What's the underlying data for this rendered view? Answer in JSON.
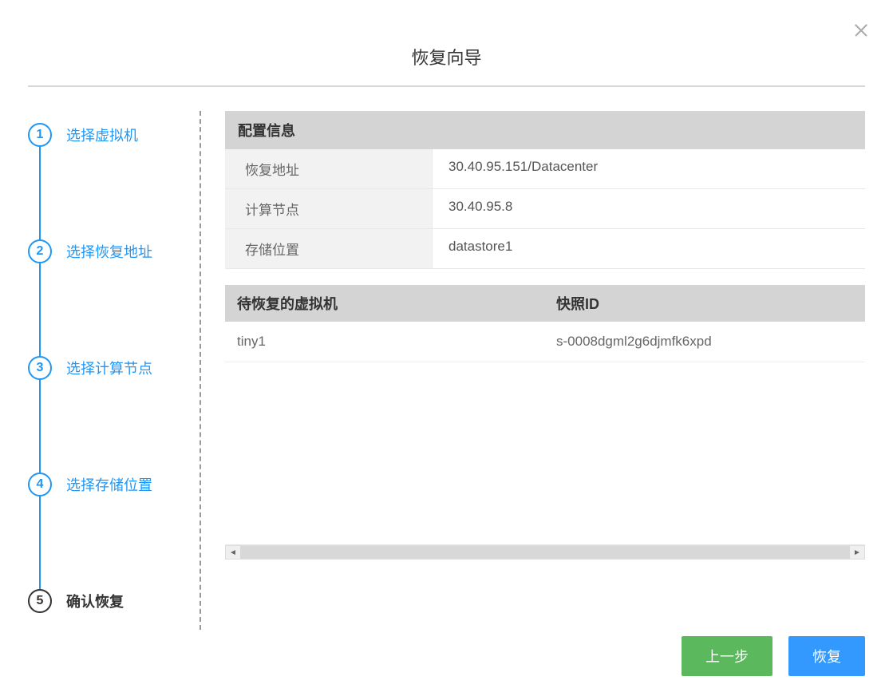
{
  "title": "恢复向导",
  "steps": [
    {
      "num": "1",
      "label": "选择虚拟机"
    },
    {
      "num": "2",
      "label": "选择恢复地址"
    },
    {
      "num": "3",
      "label": "选择计算节点"
    },
    {
      "num": "4",
      "label": "选择存储位置"
    },
    {
      "num": "5",
      "label": "确认恢复"
    }
  ],
  "config": {
    "header": "配置信息",
    "rows": [
      {
        "label": "恢复地址",
        "value": "30.40.95.151/Datacenter"
      },
      {
        "label": "计算节点",
        "value": "30.40.95.8"
      },
      {
        "label": "存储位置",
        "value": "datastore1"
      }
    ]
  },
  "table": {
    "headers": {
      "vm": "待恢复的虚拟机",
      "snap": "快照ID"
    },
    "rows": [
      {
        "vm": "tiny1",
        "snap": "s-0008dgml2g6djmfk6xpd"
      }
    ]
  },
  "buttons": {
    "prev": "上一步",
    "submit": "恢复"
  }
}
